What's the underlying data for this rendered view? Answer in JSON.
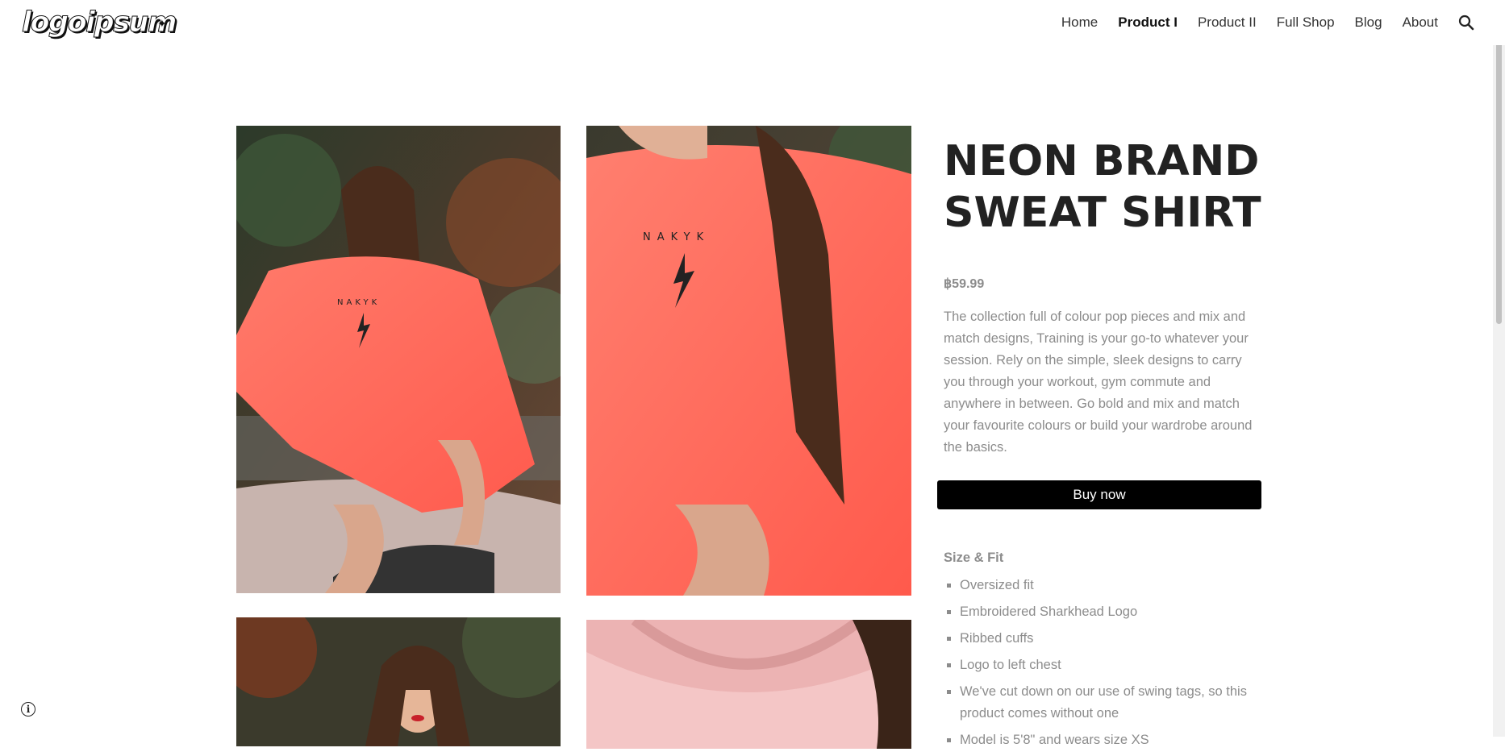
{
  "header": {
    "logo_text": "logoipsum",
    "nav": [
      {
        "label": "Home",
        "active": false
      },
      {
        "label": "Product I",
        "active": true
      },
      {
        "label": "Product II",
        "active": false
      },
      {
        "label": "Full Shop",
        "active": false
      },
      {
        "label": "Blog",
        "active": false
      },
      {
        "label": "About",
        "active": false
      }
    ],
    "search_icon": "search-icon"
  },
  "gallery": {
    "images": [
      {
        "name": "product-image-1"
      },
      {
        "name": "product-image-2"
      },
      {
        "name": "product-image-3"
      },
      {
        "name": "product-image-4"
      }
    ],
    "shirt_print_text": "NAKYK"
  },
  "product": {
    "title": "NEON BRAND SWEAT SHIRT",
    "price": "฿59.99",
    "description": "The collection full of colour pop pieces and mix and match designs, Training is your go-to whatever your session. Rely on the simple, sleek designs to carry you through your workout, gym commute and anywhere in between. Go bold and mix and match your favourite colours or build your wardrobe around the basics.",
    "buy_label": "Buy now",
    "size_fit_title": "Size & Fit",
    "features": [
      "Oversized fit",
      "Embroidered Sharkhead Logo",
      "Ribbed cuffs",
      "Logo to left chest",
      "We've cut down on our use of swing tags, so this product comes without one",
      "Model is 5'8\" and wears size XS"
    ]
  },
  "colors": {
    "accent": "#000000",
    "text_muted": "#8c8c8c",
    "shirt": "#ff6b5e"
  },
  "info_icon": "info-icon"
}
